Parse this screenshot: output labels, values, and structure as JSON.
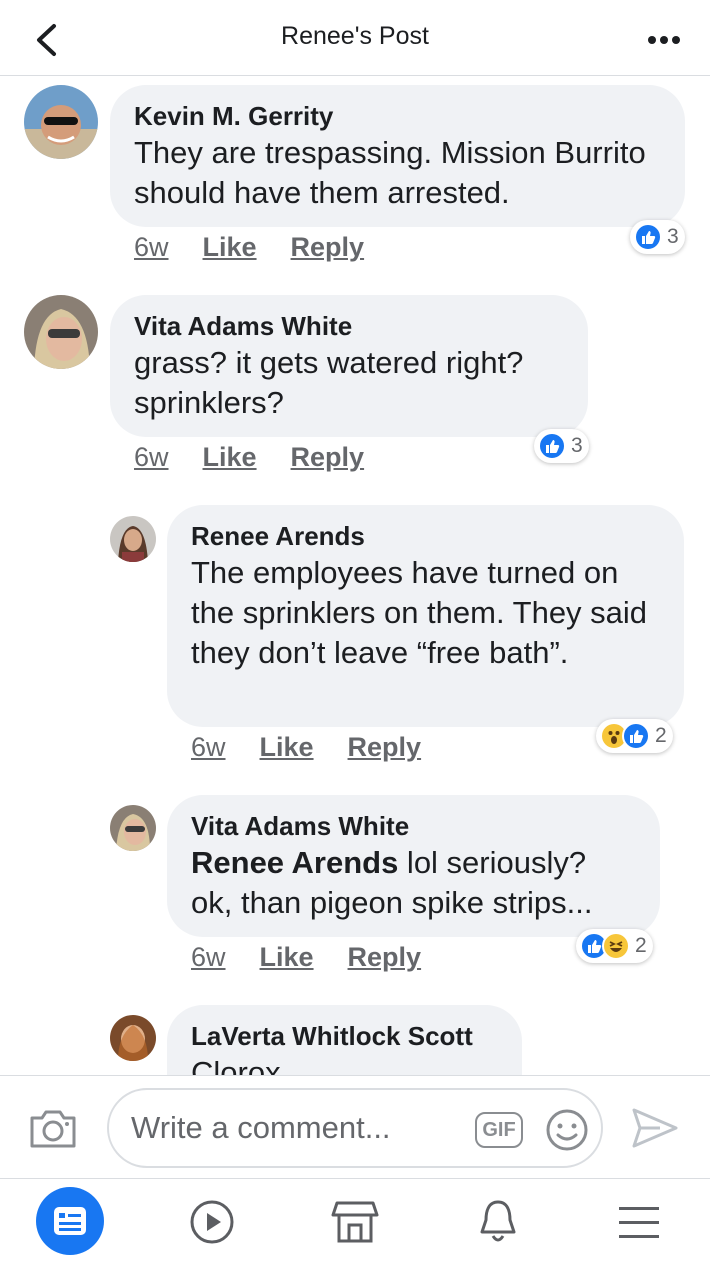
{
  "header": {
    "title": "Renee's Post"
  },
  "comments": [
    {
      "author": "Kevin M. Gerrity",
      "text": "They are trespassing. Mission Burrito should have them arrested.",
      "time": "6w",
      "like_label": "Like",
      "reply_label": "Reply",
      "reaction_count": "3",
      "reactions": [
        "like"
      ]
    },
    {
      "author": "Vita Adams White",
      "text": "grass? it gets watered right? sprinklers?",
      "time": "6w",
      "like_label": "Like",
      "reply_label": "Reply",
      "reaction_count": "3",
      "reactions": [
        "like"
      ]
    },
    {
      "author": "Renee Arends",
      "text": "The employees have turned on the sprinklers on them. They said they don’t leave “free bath”.",
      "time": "6w",
      "like_label": "Like",
      "reply_label": "Reply",
      "reaction_count": "2",
      "reactions": [
        "wow",
        "like"
      ]
    },
    {
      "author": "Vita Adams White",
      "mention": "Renee Arends",
      "text": " lol   seriously? ok, than pigeon spike strips...",
      "time": "6w",
      "like_label": "Like",
      "reply_label": "Reply",
      "reaction_count": "2",
      "reactions": [
        "like",
        "haha"
      ]
    },
    {
      "author": "LaVerta Whitlock Scott",
      "text": "Clorox"
    }
  ],
  "composer": {
    "placeholder": "Write a comment...",
    "gif_label": "GIF"
  },
  "icons": {
    "back": "chevron-left-icon",
    "more": "more-dots-icon",
    "camera": "camera-icon",
    "emoji": "smiley-icon",
    "send": "send-icon",
    "feed": "news-feed-icon",
    "watch": "play-icon",
    "marketplace": "store-icon",
    "notifications": "bell-icon",
    "menu": "hamburger-icon"
  },
  "colors": {
    "accent": "#1877f2",
    "bubble": "#f0f2f5",
    "meta": "#65676b"
  }
}
